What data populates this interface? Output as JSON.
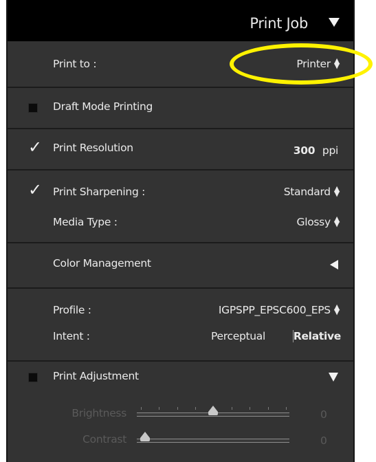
{
  "header": {
    "title": "Print Job"
  },
  "print_to": {
    "label": "Print to :",
    "value": "Printer"
  },
  "draft_mode": {
    "label": "Draft Mode Printing",
    "checked": false
  },
  "print_resolution": {
    "label": "Print Resolution",
    "checked": true,
    "value": "300",
    "unit": "ppi"
  },
  "print_sharpening": {
    "label": "Print Sharpening :",
    "checked": true,
    "value": "Standard"
  },
  "media_type": {
    "label": "Media Type :",
    "value": "Glossy"
  },
  "color_management": {
    "label": "Color Management"
  },
  "profile": {
    "label": "Profile :",
    "value": "IGPSPP_EPSC600_EPS"
  },
  "intent": {
    "label": "Intent :",
    "options": [
      "Perceptual",
      "Relative"
    ],
    "selected": "Relative"
  },
  "print_adjustment": {
    "label": "Print Adjustment",
    "checked": false
  },
  "brightness": {
    "label": "Brightness",
    "value": "0",
    "position": 0.5
  },
  "contrast": {
    "label": "Contrast",
    "value": "0",
    "position": 0.0
  },
  "colors": {
    "panel_bg": "#333333",
    "header_bg": "#000000",
    "highlight": "#fff200"
  }
}
